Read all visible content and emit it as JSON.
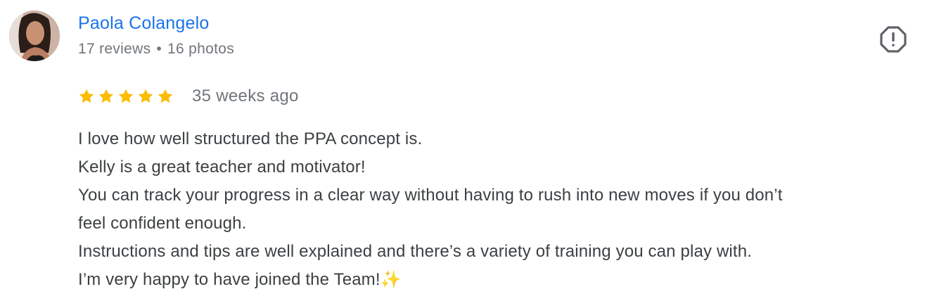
{
  "review": {
    "author": {
      "name": "Paola Colangelo",
      "reviews": "17 reviews",
      "separator": "•",
      "photos": "16 photos",
      "avatar_icon": "user-avatar-photo"
    },
    "flag_icon": "report-flag-icon",
    "rating": {
      "stars": 5,
      "max": 5,
      "star_color": "#fbbc04",
      "time_ago": "35 weeks ago"
    },
    "text_lines": [
      "I love how well structured the PPA concept is.",
      "Kelly is a great teacher and motivator!",
      "You can track your progress in a clear way without having to rush into new moves if you don’t",
      "feel confident enough.",
      "Instructions and tips are well explained and there’s a variety of training you can play with.",
      "I’m very happy to have joined the Team!"
    ],
    "emoji": "✨"
  },
  "colors": {
    "link": "#1a73e8",
    "secondary": "#70757a",
    "body_text": "#3c4043",
    "icon": "#5f6368"
  }
}
